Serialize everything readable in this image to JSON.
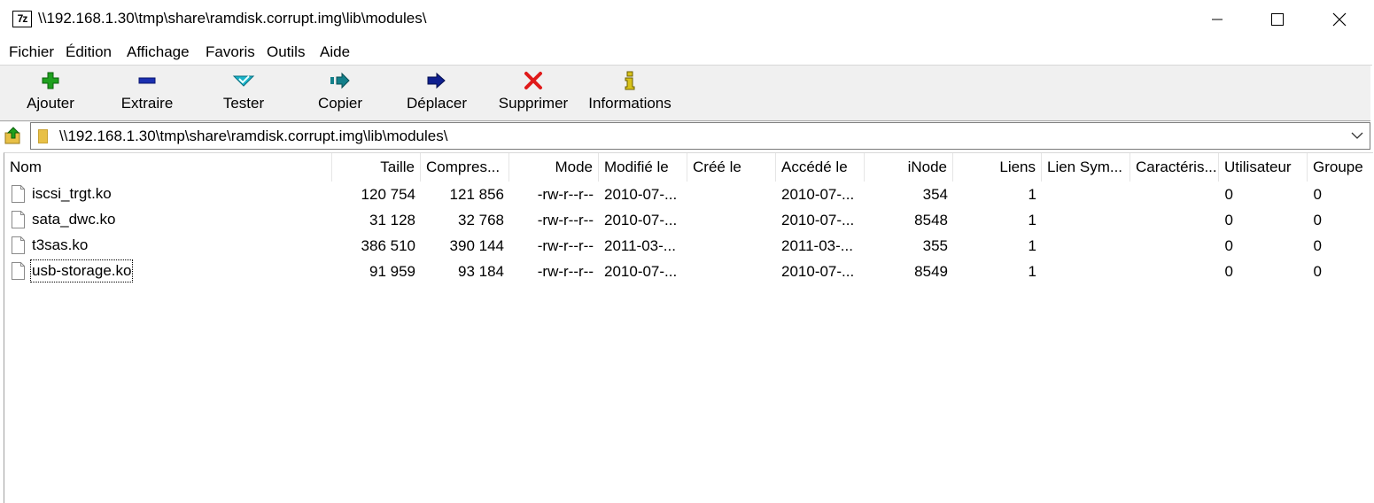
{
  "window": {
    "title": "\\\\192.168.1.30\\tmp\\share\\ramdisk.corrupt.img\\lib\\modules\\",
    "app_icon_text": "7z"
  },
  "menu": [
    "Fichier",
    "Édition",
    "Affichage",
    "Favoris",
    "Outils",
    "Aide"
  ],
  "toolbar": [
    {
      "label": "Ajouter",
      "icon": "add-icon",
      "color": "#1ea01e"
    },
    {
      "label": "Extraire",
      "icon": "extract-icon",
      "color": "#1a2fb0"
    },
    {
      "label": "Tester",
      "icon": "test-icon",
      "color": "#19b3c8"
    },
    {
      "label": "Copier",
      "icon": "copy-icon",
      "color": "#137f8a"
    },
    {
      "label": "Déplacer",
      "icon": "move-icon",
      "color": "#0f1f8f"
    },
    {
      "label": "Supprimer",
      "icon": "delete-icon",
      "color": "#e01a1a"
    },
    {
      "label": "Informations",
      "icon": "info-icon",
      "color": "#d8c21a"
    }
  ],
  "address": {
    "path": "\\\\192.168.1.30\\tmp\\share\\ramdisk.corrupt.img\\lib\\modules\\"
  },
  "columns": [
    "Nom",
    "Taille",
    "Compres...",
    "Mode",
    "Modifié le",
    "Créé le",
    "Accédé le",
    "iNode",
    "Liens",
    "Lien Sym...",
    "Caractéris...",
    "Utilisateur",
    "Groupe"
  ],
  "files": [
    {
      "name": "iscsi_trgt.ko",
      "size": "120 754",
      "packed": "121 856",
      "mode": "-rw-r--r--",
      "modified": "2010-07-...",
      "created": "",
      "accessed": "2010-07-...",
      "inode": "354",
      "links": "1",
      "symlink": "",
      "chars": "",
      "user": "0",
      "group": "0"
    },
    {
      "name": "sata_dwc.ko",
      "size": "31 128",
      "packed": "32 768",
      "mode": "-rw-r--r--",
      "modified": "2010-07-...",
      "created": "",
      "accessed": "2010-07-...",
      "inode": "8548",
      "links": "1",
      "symlink": "",
      "chars": "",
      "user": "0",
      "group": "0"
    },
    {
      "name": "t3sas.ko",
      "size": "386 510",
      "packed": "390 144",
      "mode": "-rw-r--r--",
      "modified": "2011-03-...",
      "created": "",
      "accessed": "2011-03-...",
      "inode": "355",
      "links": "1",
      "symlink": "",
      "chars": "",
      "user": "0",
      "group": "0"
    },
    {
      "name": "usb-storage.ko",
      "size": "91 959",
      "packed": "93 184",
      "mode": "-rw-r--r--",
      "modified": "2010-07-...",
      "created": "",
      "accessed": "2010-07-...",
      "inode": "8549",
      "links": "1",
      "symlink": "",
      "chars": "",
      "user": "0",
      "group": "0"
    }
  ]
}
